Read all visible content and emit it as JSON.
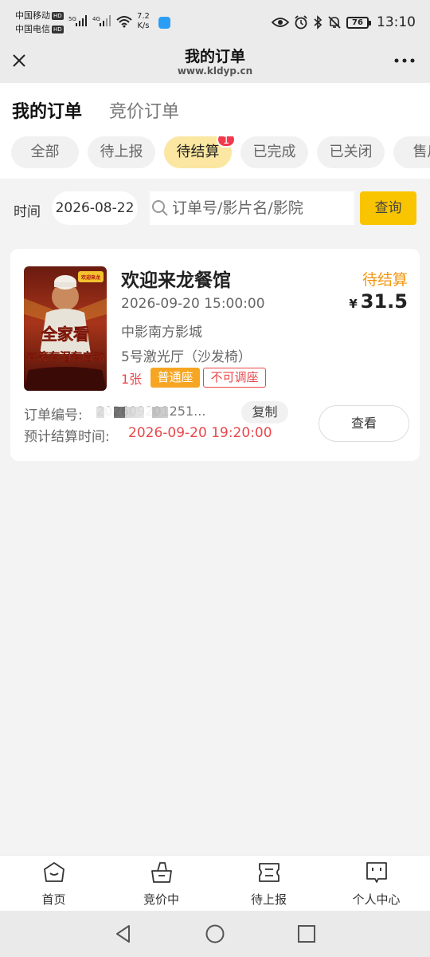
{
  "status_bar": {
    "carrier1": "中国移动",
    "carrier2": "中国电信",
    "hd": "HD",
    "net_5g": "5G",
    "net_4g": "4G",
    "speed_value": "7.2",
    "speed_unit": "K/s",
    "battery": "76",
    "time": "13:10"
  },
  "nav": {
    "title": "我的订单",
    "url": "www.kldyp.cn",
    "close_icon": "close-icon",
    "more_icon": "more-icon"
  },
  "main_tabs": [
    "我的订单",
    "竞价订单"
  ],
  "filters": [
    {
      "label": "全部"
    },
    {
      "label": "待上报"
    },
    {
      "label": "待结算",
      "badge": "1",
      "active": true
    },
    {
      "label": "已完成"
    },
    {
      "label": "已关闭"
    },
    {
      "label": "售后"
    }
  ],
  "search": {
    "time_label": "时间",
    "date_value": "2026-08-22",
    "placeholder": "订单号/影片名/影院",
    "query_label": "查询"
  },
  "order": {
    "movie_name": "欢迎来龙餐馆",
    "status": "待结算",
    "price_symbol": "¥",
    "price": "31.5",
    "showtime": "2026-09-20 15:00:00",
    "cinema": "中影南方影城",
    "hall": "5号激光厅（沙发椅）",
    "ticket_count": "1张",
    "seat_type": "普通座",
    "seat_adjust": "不可调座",
    "order_no_label": "订单编号:",
    "order_no_value": "202609201251...",
    "copy_label": "复制",
    "settle_label": "预计结算时间:",
    "settle_time": "2026-09-20 19:20:00",
    "view_label": "查看",
    "poster_text_1": "全家看",
    "poster_text_2": "有笑有泪有启动",
    "poster_logo": "欢迎来龙"
  },
  "tabbar": [
    {
      "label": "首页",
      "icon": "home-icon"
    },
    {
      "label": "竞价中",
      "icon": "bag-icon"
    },
    {
      "label": "待上报",
      "icon": "ticket-icon"
    },
    {
      "label": "个人中心",
      "icon": "profile-icon"
    }
  ],
  "colors": {
    "accent_yellow": "#f9c400",
    "status_orange": "#f29611",
    "alert_red": "#e8484b",
    "badge_red": "#f2394d"
  }
}
